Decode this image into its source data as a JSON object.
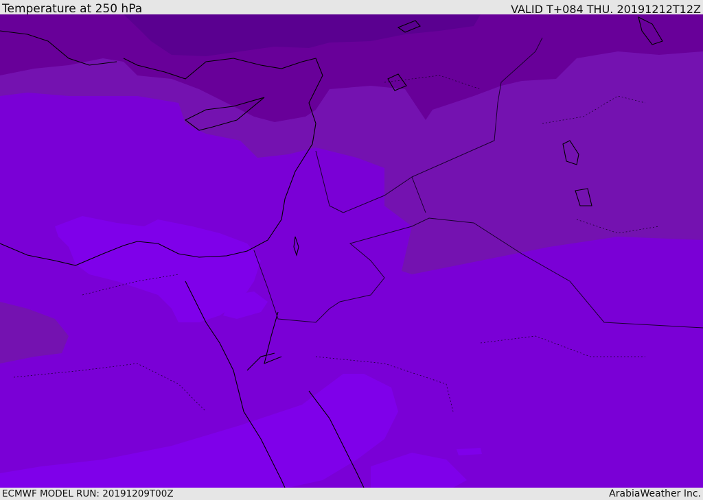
{
  "header": {
    "title": "Temperature at 250 hPa",
    "valid_time": "VALID T+084 THU. 20191212T12Z"
  },
  "footer": {
    "model_run": "ECMWF MODEL RUN: 20191209T00Z",
    "credit": "ArabiaWeather Inc."
  },
  "map": {
    "variable": "temperature",
    "pressure_level_hpa": 250,
    "colors": {
      "coldest": "#5a0090",
      "very_cold": "#680099",
      "cold": "#7412b0",
      "base": "#7a00d6",
      "mild": "#7f00ea",
      "warmest": "#8800ff",
      "coastline": "#000000",
      "borders": "#1a0030"
    }
  }
}
